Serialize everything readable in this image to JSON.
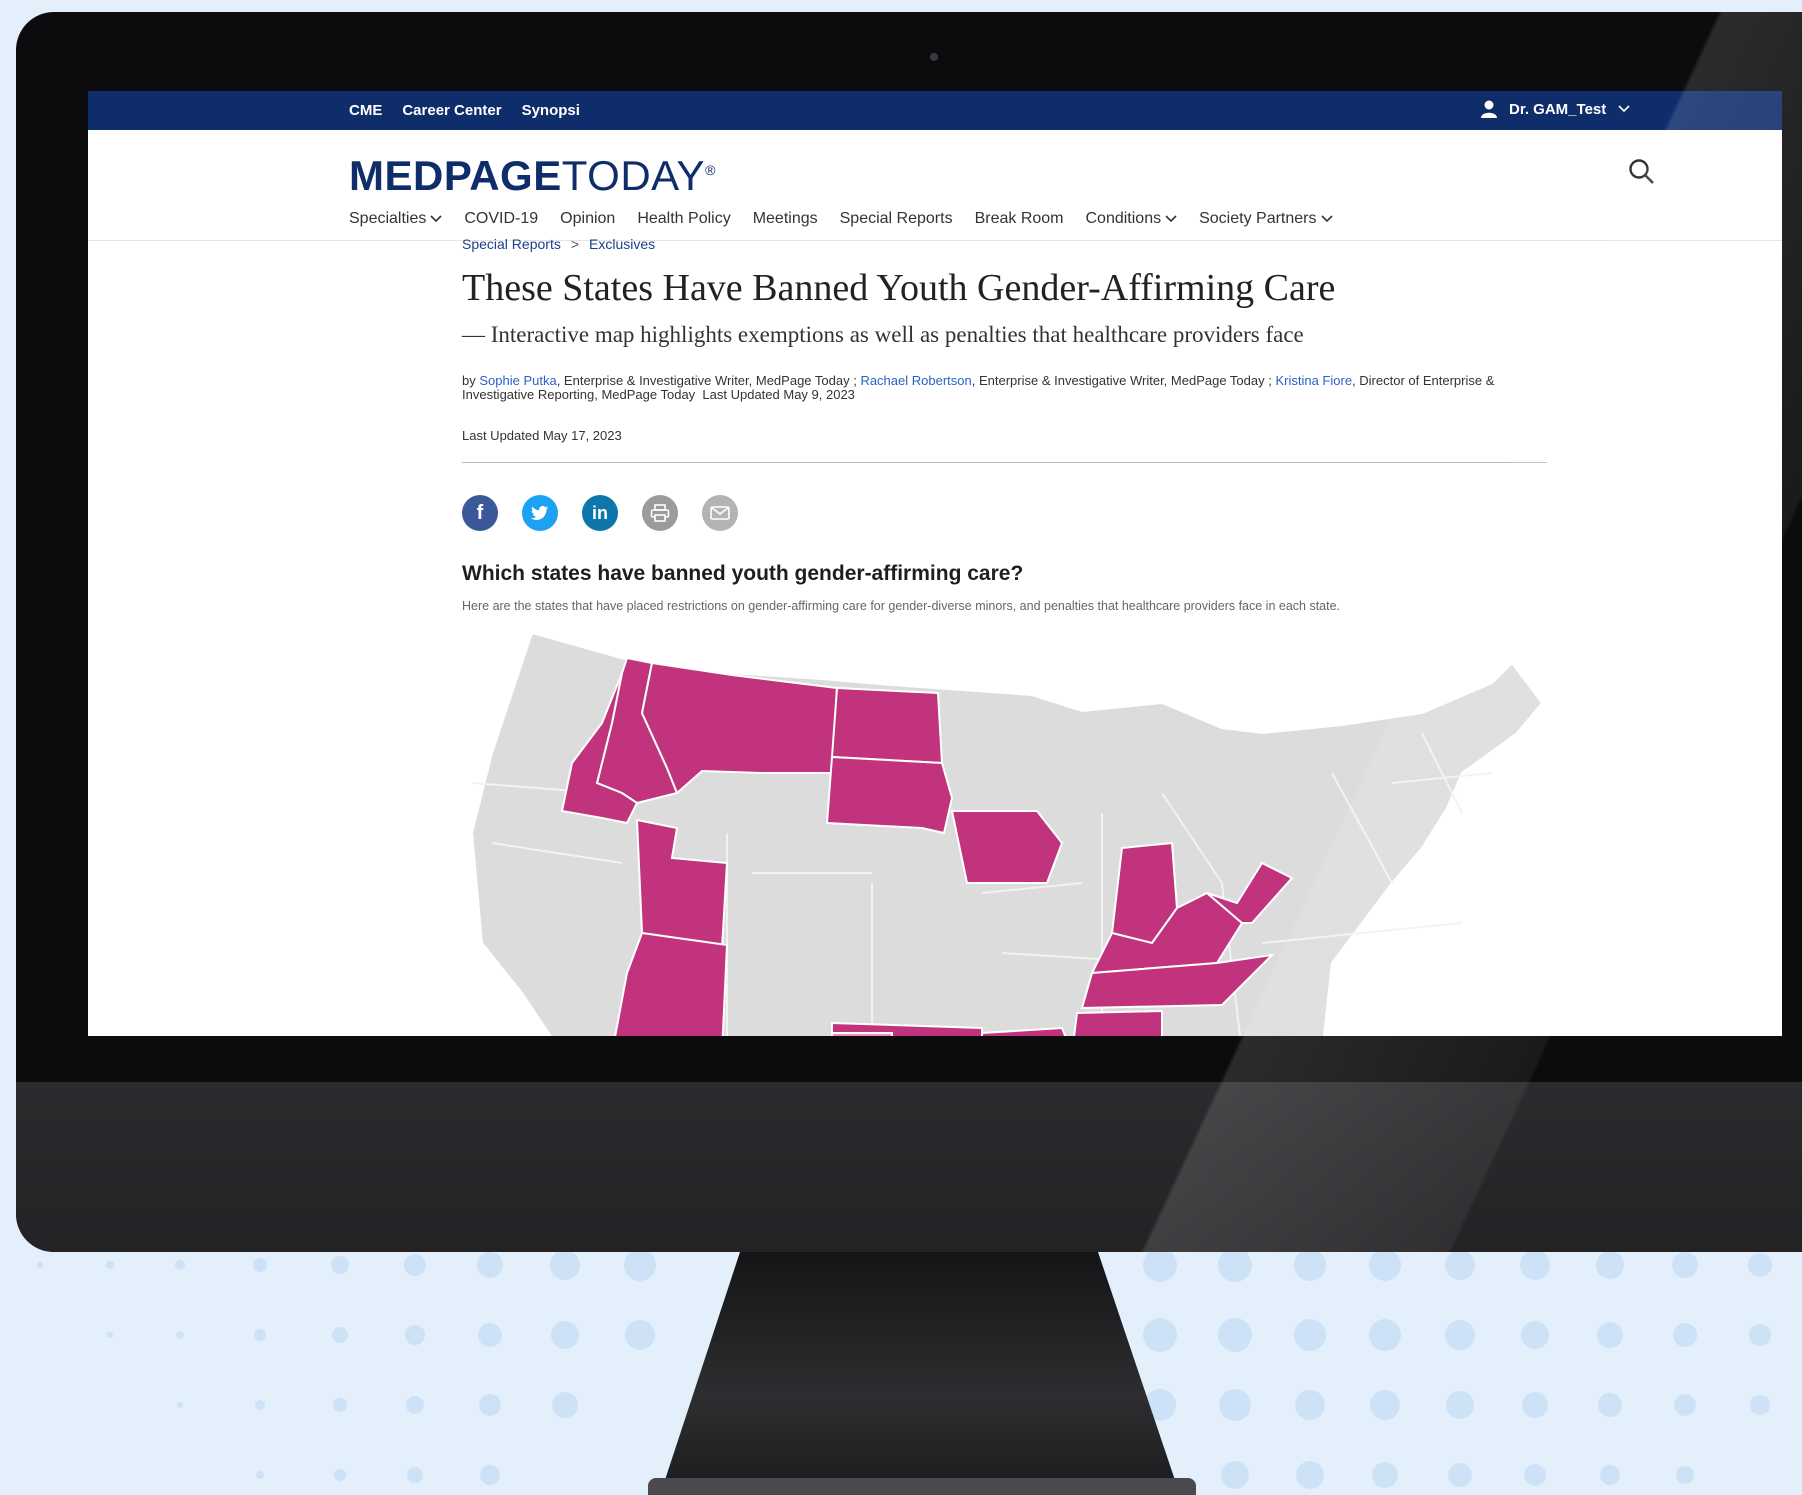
{
  "topbar": {
    "links": [
      "CME",
      "Career Center",
      "Synopsi"
    ],
    "user_name": "Dr. GAM_Test"
  },
  "brand": {
    "logo_bold": "MEDPAGE",
    "logo_light": "TODAY"
  },
  "nav": {
    "items": [
      "Specialties",
      "COVID-19",
      "Opinion",
      "Health Policy",
      "Meetings",
      "Special Reports",
      "Break Room",
      "Conditions",
      "Society Partners"
    ]
  },
  "article": {
    "breadcrumb": [
      "Special Reports",
      ">",
      "Exclusives"
    ],
    "title": "These States Have Banned Youth Gender-Affirming Care",
    "subtitle": "— Interactive map highlights exemptions as well as penalties that healthcare providers face",
    "byline": {
      "by": "by",
      "author1": "Sophie Putka",
      "role1": ", Enterprise & Investigative Writer, MedPage Today ; ",
      "author2": "Rachael Robertson",
      "role2": ", Enterprise & Investigative Writer, MedPage Today ; ",
      "author3": "Kristina Fiore",
      "role3": ", Director of Enterprise & Investigative Reporting, MedPage Today",
      "updated": "Last Updated May 9, 2023"
    },
    "last_updated": "Last Updated May 17, 2023",
    "question_title": "Which states have banned youth gender-affirming care?",
    "question_desc": "Here are the states that have placed restrictions on gender-affirming care for gender-diverse minors, and penalties that healthcare providers face in each state."
  },
  "colors": {
    "banned": "#c1347d",
    "partial": "#f08cc0",
    "other": "#dcdcdc",
    "navy": "#0f2d6b",
    "facebook": "#3b5998",
    "twitter": "#1da1f2",
    "linkedin": "#0e76a8"
  },
  "share_icons": [
    "facebook-icon",
    "twitter-icon",
    "linkedin-icon",
    "print-icon",
    "email-icon"
  ]
}
